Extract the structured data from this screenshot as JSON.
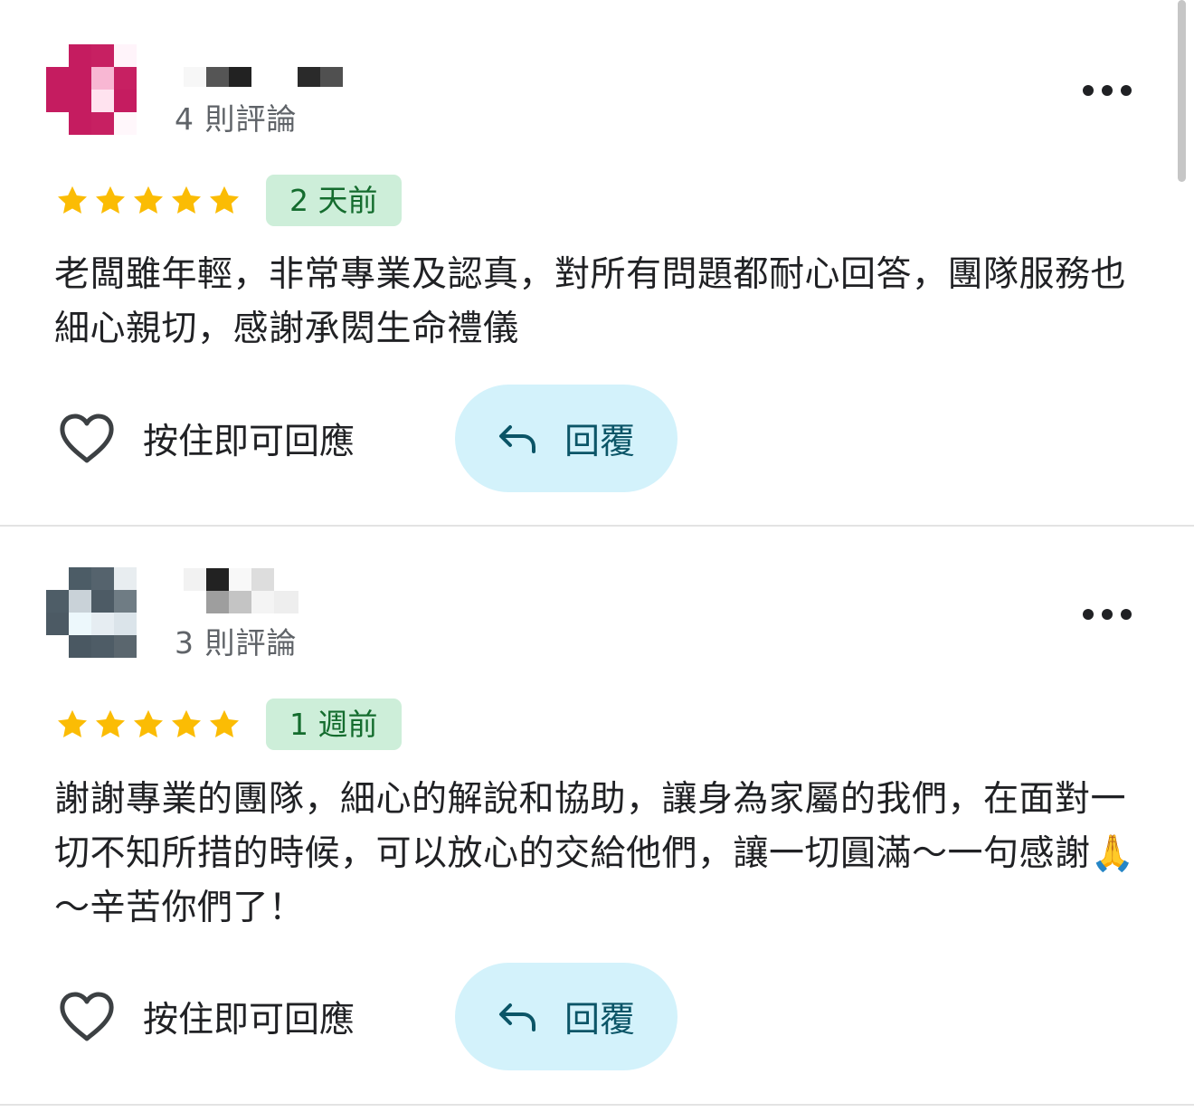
{
  "reviews": [
    {
      "review_count": "4 則評論",
      "rating": 5,
      "time_ago": "2 天前",
      "text": "老闆雖年輕，非常專業及認真，對所有問題都耐心回答，團隊服務也細心親切，感謝承閎生命禮儀",
      "like_label": "按住即可回應",
      "reply_label": "回覆"
    },
    {
      "review_count": "3 則評論",
      "rating": 5,
      "time_ago": "1 週前",
      "text": "謝謝專業的團隊，細心的解說和協助，讓身為家屬的我們，在面對一切不知所措的時候，可以放心的交給他們，讓一切圓滿～一句感謝🙏～辛苦你們了！",
      "like_label": "按住即可回應",
      "reply_label": "回覆"
    }
  ],
  "colors": {
    "star": "#fbbc04",
    "badge_bg": "#cdeed9",
    "badge_text": "#146c2e",
    "reply_bg": "#d3f2fb",
    "reply_text": "#0b5567"
  },
  "icons": {
    "more": "more-horizontal-icon",
    "like": "heart-outline-icon",
    "reply": "reply-arrow-icon",
    "star": "star-icon"
  }
}
